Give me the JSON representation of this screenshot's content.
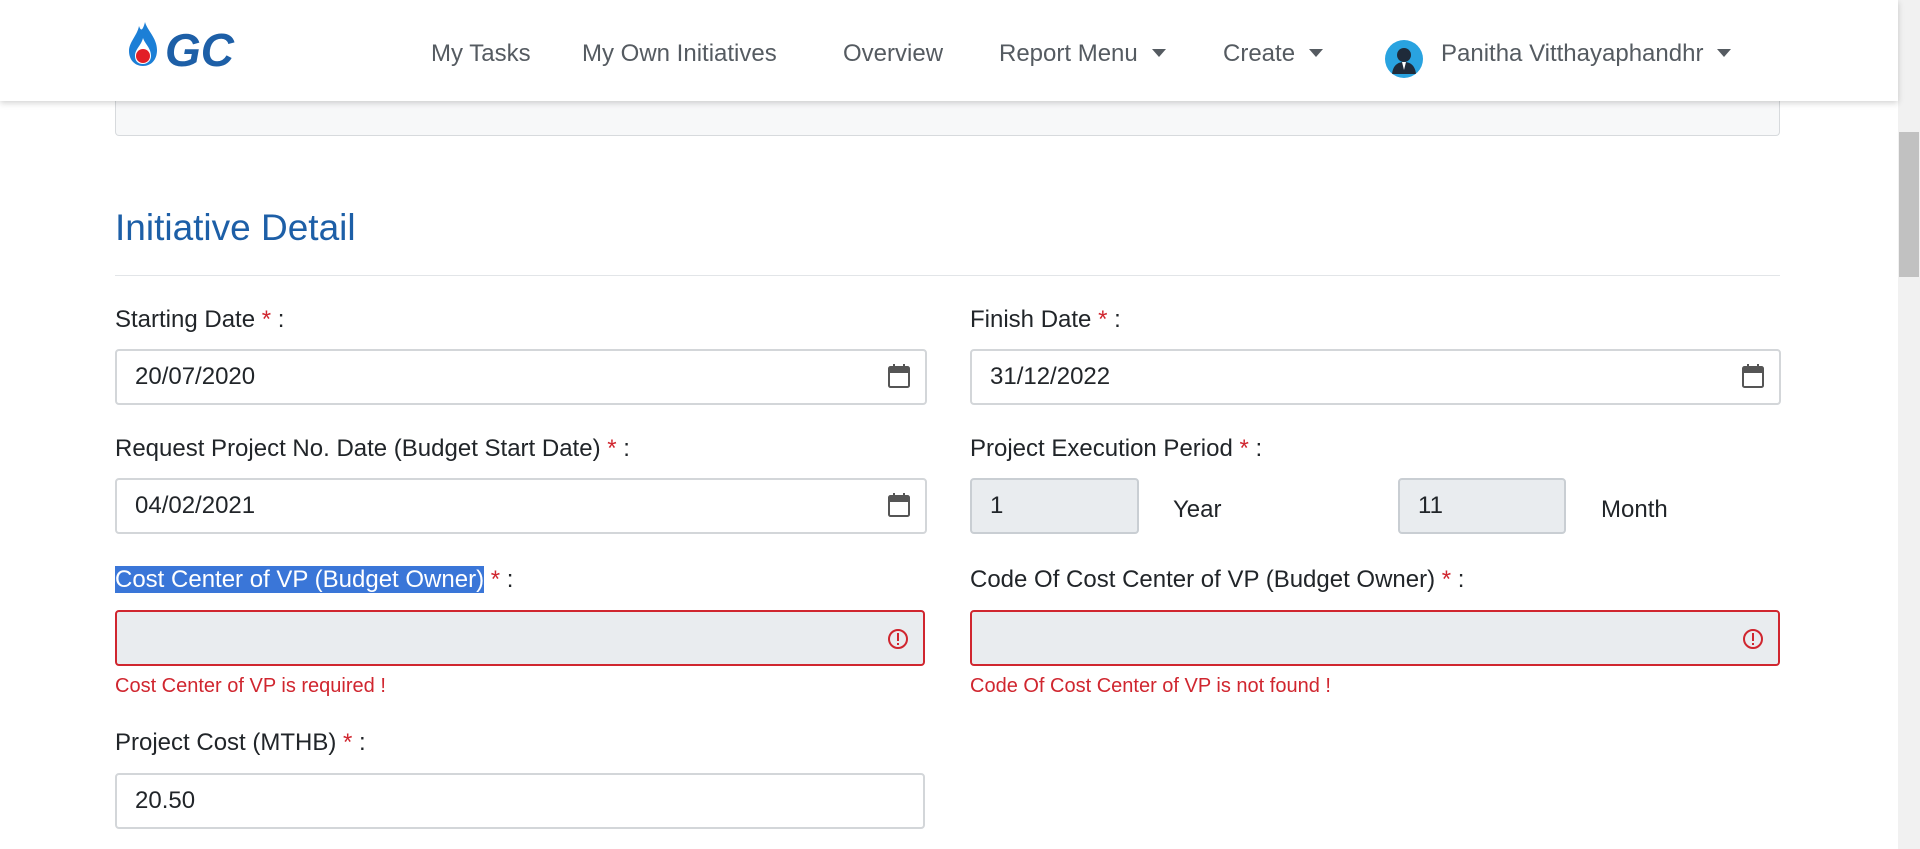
{
  "nav": {
    "logo_text": "GC",
    "links": [
      "My Tasks",
      "My Own Initiatives",
      "Overview",
      "Report Menu",
      "Create"
    ],
    "user_name": "Panitha Vitthayaphandhr",
    "brand_color": "#1d5fa7"
  },
  "section": {
    "title": "Initiative Detail"
  },
  "form": {
    "starting_date": {
      "label": "Starting Date",
      "value": "20/07/2020"
    },
    "finish_date": {
      "label": "Finish Date",
      "value": "31/12/2022"
    },
    "request_date": {
      "label": "Request Project No. Date (Budget Start Date)",
      "value": "04/02/2021"
    },
    "execution_period": {
      "label": "Project Execution Period",
      "years": "1",
      "year_unit": "Year",
      "months": "11",
      "month_unit": "Month"
    },
    "cost_center": {
      "label": "Cost Center of VP (Budget Owner)",
      "value": "",
      "error": "Cost Center of VP is required !"
    },
    "code_cost_center": {
      "label": "Code Of Cost Center of VP (Budget Owner)",
      "value": "",
      "error": "Code Of Cost Center of VP is not found !"
    },
    "project_cost": {
      "label": "Project Cost (MTHB)",
      "value": "20.50"
    },
    "required_mark": "*",
    "colon": ":"
  }
}
